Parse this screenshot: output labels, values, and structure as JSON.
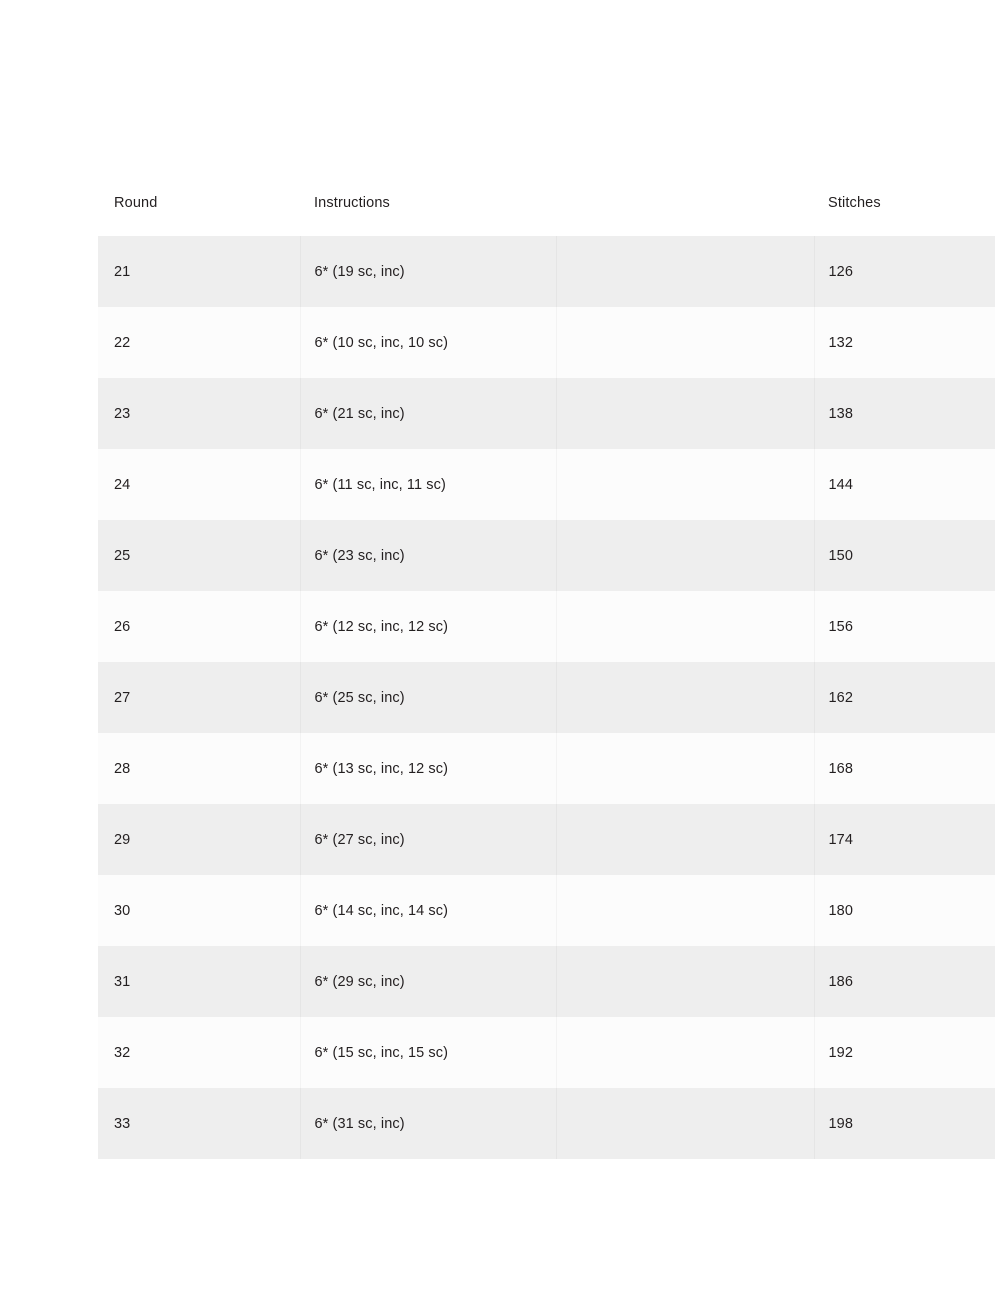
{
  "table": {
    "columns": [
      {
        "key": "round",
        "label": "Round"
      },
      {
        "key": "instructions",
        "label": "Instructions"
      },
      {
        "key": "spacer",
        "label": ""
      },
      {
        "key": "stitches",
        "label": "Stitches"
      }
    ],
    "rows": [
      {
        "round": "21",
        "instructions": "6* (19 sc, inc)",
        "stitches": "126"
      },
      {
        "round": "22",
        "instructions": "6* (10 sc, inc, 10 sc)",
        "stitches": "132"
      },
      {
        "round": "23",
        "instructions": "6* (21 sc, inc)",
        "stitches": "138"
      },
      {
        "round": "24",
        "instructions": "6* (11 sc, inc, 11 sc)",
        "stitches": "144"
      },
      {
        "round": "25",
        "instructions": "6* (23 sc, inc)",
        "stitches": "150"
      },
      {
        "round": "26",
        "instructions": "6* (12 sc, inc, 12 sc)",
        "stitches": "156"
      },
      {
        "round": "27",
        "instructions": "6* (25 sc, inc)",
        "stitches": "162"
      },
      {
        "round": "28",
        "instructions": "6* (13 sc, inc, 12 sc)",
        "stitches": "168"
      },
      {
        "round": "29",
        "instructions": "6* (27 sc, inc)",
        "stitches": "174"
      },
      {
        "round": "30",
        "instructions": "6* (14 sc, inc, 14 sc)",
        "stitches": "180"
      },
      {
        "round": "31",
        "instructions": "6* (29 sc, inc)",
        "stitches": "186"
      },
      {
        "round": "32",
        "instructions": "6* (15 sc, inc, 15 sc)",
        "stitches": "192"
      },
      {
        "round": "33",
        "instructions": "6* (31 sc, inc)",
        "stitches": "198"
      }
    ]
  },
  "colors": {
    "page_background": "#ffffff",
    "row_shaded": "#eeeeee",
    "row_plain": "#fcfcfc",
    "text": "#231f20"
  }
}
